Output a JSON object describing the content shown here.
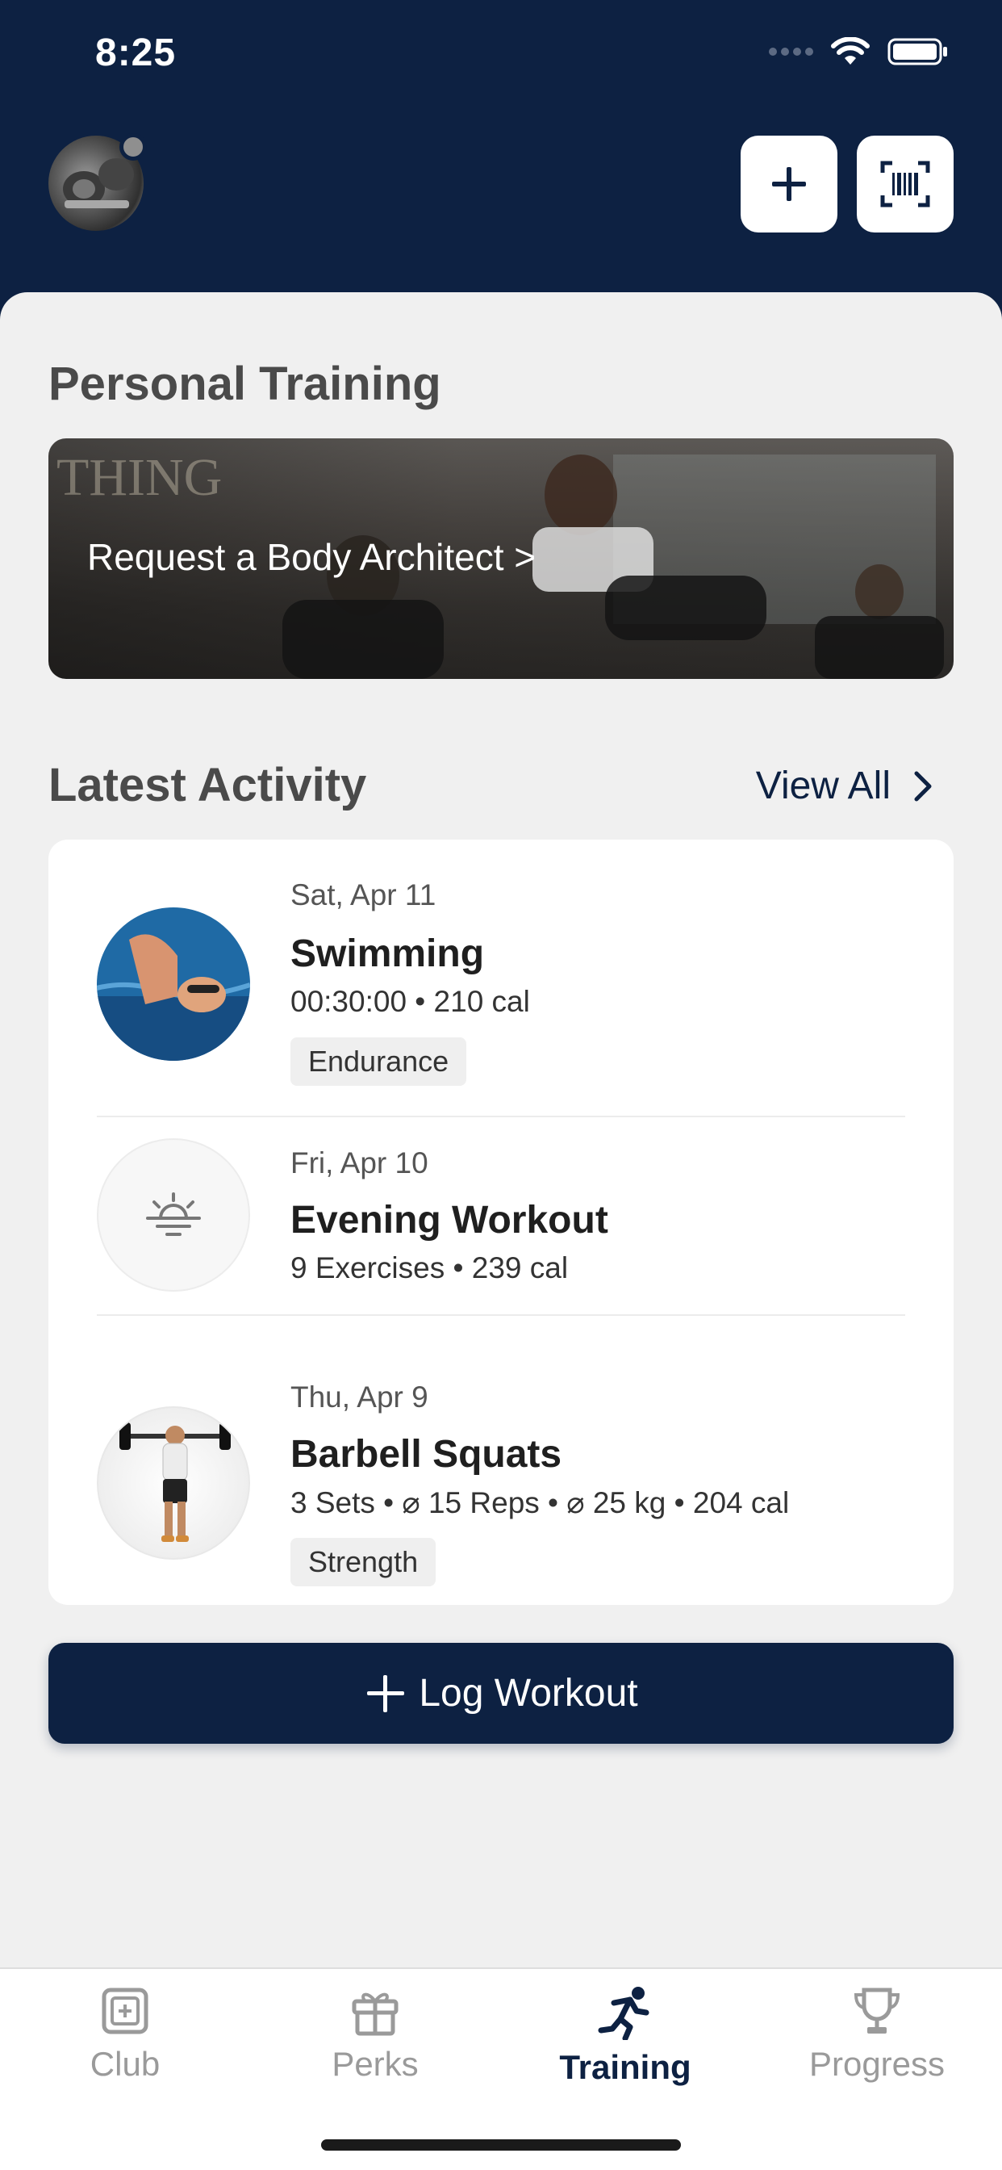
{
  "status_bar": {
    "time": "8:25"
  },
  "header": {
    "add_icon": "plus-icon",
    "scan_icon": "barcode-scan-icon"
  },
  "personal_training": {
    "title": "Personal Training",
    "banner_label": "Request a Body Architect >"
  },
  "latest_activity": {
    "title": "Latest Activity",
    "view_all": "View All",
    "items": [
      {
        "date": "Sat, Apr 11",
        "title": "Swimming",
        "meta": "00:30:00 • 210 cal",
        "tag": "Endurance"
      },
      {
        "date": "Fri, Apr 10",
        "title": "Evening Workout",
        "meta": "9 Exercises • 239 cal"
      },
      {
        "date": "Thu, Apr 9",
        "title": "Barbell Squats",
        "meta": "3 Sets • ⌀ 15 Reps • ⌀ 25 kg • 204 cal",
        "tag": "Strength"
      }
    ]
  },
  "log_button": {
    "label": "Log Workout"
  },
  "tabs": [
    {
      "label": "Club",
      "icon": "club-icon"
    },
    {
      "label": "Perks",
      "icon": "gift-icon"
    },
    {
      "label": "Training",
      "icon": "running-icon",
      "active": true
    },
    {
      "label": "Progress",
      "icon": "trophy-icon"
    }
  ],
  "colors": {
    "navy": "#0d2142",
    "background": "#f0f0f0",
    "inactive_tab": "#9a9a9a"
  }
}
